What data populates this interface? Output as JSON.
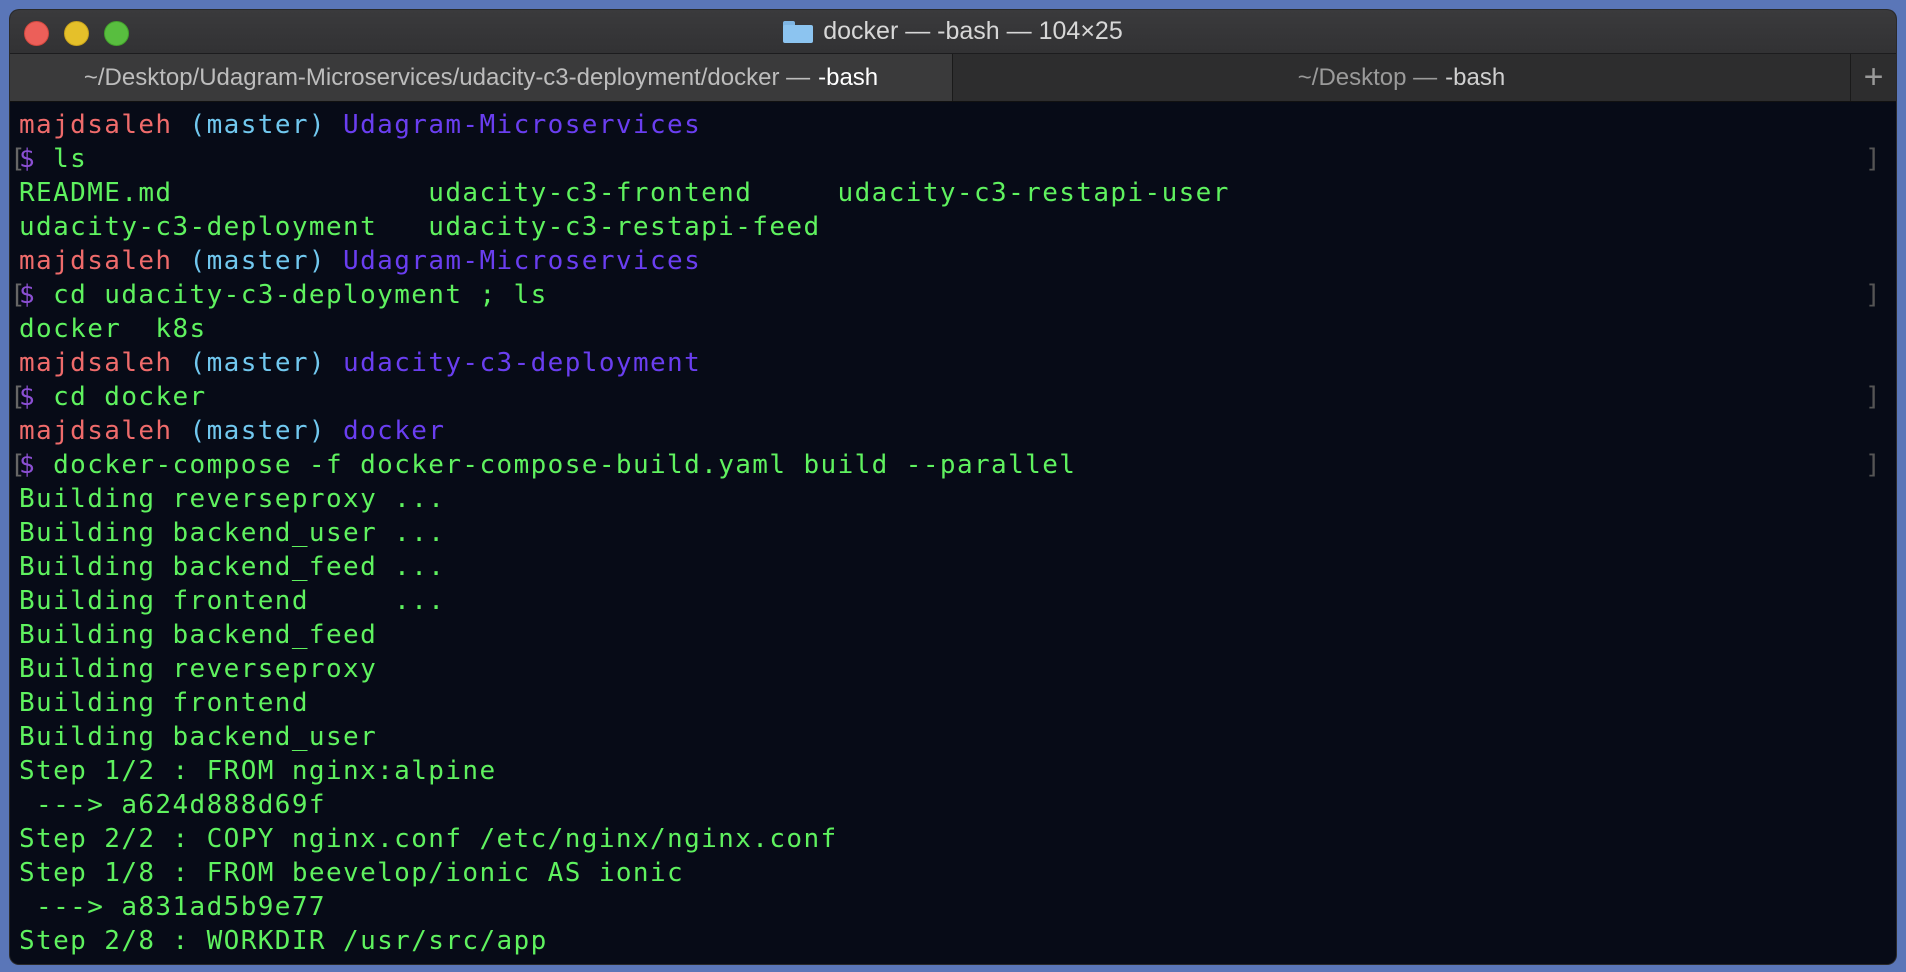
{
  "window": {
    "title": "docker — -bash — 104×25",
    "tabs": [
      {
        "path": "~/Desktop/Udagram-Microservices/udacity-c3-deployment/docker —",
        "process": "-bash",
        "active": true
      },
      {
        "path": "~/Desktop —",
        "process": "-bash",
        "active": false
      }
    ],
    "new_tab_label": "+"
  },
  "colors": {
    "user": "#ef6b6b",
    "branch": "#71c8ef",
    "directory": "#6a3ef0",
    "prompt_symbol": "#8b4fd3",
    "output": "#5ff25f",
    "background": "#070b17"
  },
  "terminal": {
    "prompts": [
      {
        "user": "majdsaleh",
        "branch": "(master)",
        "dir": "Udagram-Microservices",
        "cmd": "ls"
      },
      {
        "user": "majdsaleh",
        "branch": "(master)",
        "dir": "Udagram-Microservices",
        "cmd": "cd udacity-c3-deployment ; ls"
      },
      {
        "user": "majdsaleh",
        "branch": "(master)",
        "dir": "udacity-c3-deployment",
        "cmd": "cd docker"
      },
      {
        "user": "majdsaleh",
        "branch": "(master)",
        "dir": "docker",
        "cmd": "docker-compose -f docker-compose-build.yaml build --parallel"
      }
    ],
    "dollar": "$",
    "outputs": {
      "ls1_line1": "README.md               udacity-c3-frontend     udacity-c3-restapi-user",
      "ls1_line2": "udacity-c3-deployment   udacity-c3-restapi-feed",
      "ls2_line1": "docker  k8s",
      "build": [
        "Building reverseproxy ...",
        "Building backend_user ...",
        "Building backend_feed ...",
        "Building frontend     ...",
        "Building backend_feed",
        "Building reverseproxy",
        "Building frontend",
        "Building backend_user",
        "Step 1/2 : FROM nginx:alpine",
        " ---> a624d888d69f",
        "Step 2/2 : COPY nginx.conf /etc/nginx/nginx.conf",
        "Step 1/8 : FROM beevelop/ionic AS ionic",
        " ---> a831ad5b9e77",
        "Step 2/8 : WORKDIR /usr/src/app"
      ]
    }
  }
}
